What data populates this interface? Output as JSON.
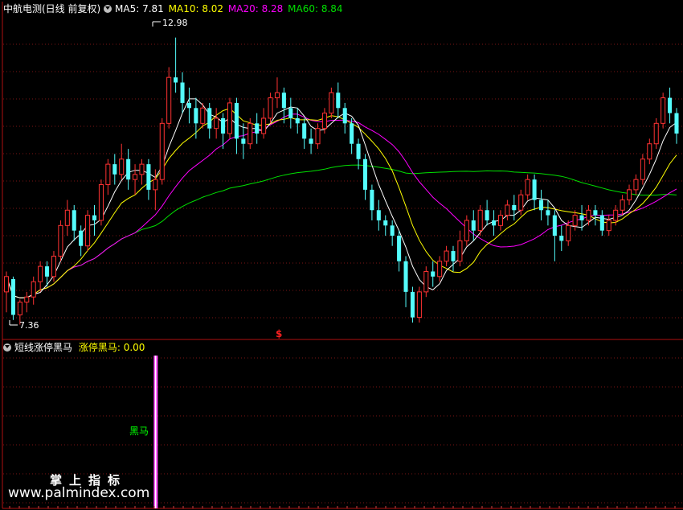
{
  "main_header": {
    "stock": "中航电测(日线 前复权)",
    "ma5_label": "MA5: 7.81",
    "ma10_label": "MA10: 8.02",
    "ma20_label": "MA20: 8.28",
    "ma60_label": "MA60: 8.84"
  },
  "sub_header": {
    "indicator": "短线涨停黑马",
    "value_label": "涨停黑马: 0.00"
  },
  "annotations": {
    "high": "12.98",
    "low": "7.36",
    "signal_marker": "$",
    "signal_text": "黑马"
  },
  "watermark": {
    "line1": "掌上指标",
    "line2": "www.palmindex.com"
  },
  "colors": {
    "up": "#ff3232",
    "down": "#54fcfc",
    "ma5": "#ffffff",
    "ma10": "#ffff00",
    "ma20": "#ff00ff",
    "ma60": "#00e000",
    "frame": "#b01010",
    "signal": "#ff40ff"
  },
  "chart_data": {
    "type": "candlestick",
    "price_range": [
      7.1,
      13.4
    ],
    "high_value": 12.98,
    "low_value": 7.36,
    "signal_bar_index": 22,
    "candles": [
      [
        8.0,
        8.3,
        8.4,
        7.6
      ],
      [
        8.25,
        7.55,
        8.3,
        7.45
      ],
      [
        7.55,
        7.8,
        7.85,
        7.36
      ],
      [
        7.8,
        7.9,
        8.0,
        7.6
      ],
      [
        7.9,
        8.2,
        8.3,
        7.75
      ],
      [
        8.2,
        8.5,
        8.6,
        8.0
      ],
      [
        8.5,
        8.3,
        8.6,
        8.1
      ],
      [
        8.3,
        8.7,
        8.8,
        8.2
      ],
      [
        8.7,
        9.3,
        9.4,
        8.6
      ],
      [
        9.3,
        9.6,
        9.8,
        9.1
      ],
      [
        9.6,
        9.2,
        9.7,
        9.0
      ],
      [
        9.2,
        8.9,
        9.3,
        8.7
      ],
      [
        8.9,
        9.5,
        9.6,
        8.8
      ],
      [
        9.5,
        9.4,
        9.7,
        9.1
      ],
      [
        9.4,
        10.1,
        10.2,
        9.3
      ],
      [
        10.1,
        10.5,
        10.6,
        9.9
      ],
      [
        10.5,
        10.3,
        10.7,
        10.1
      ],
      [
        10.3,
        10.6,
        10.9,
        10.2
      ],
      [
        10.6,
        10.2,
        10.8,
        10.0
      ],
      [
        10.2,
        10.3,
        10.5,
        9.9
      ],
      [
        10.3,
        10.5,
        10.6,
        10.1
      ],
      [
        10.5,
        10.0,
        10.6,
        9.8
      ],
      [
        10.0,
        10.2,
        10.4,
        9.6
      ],
      [
        10.2,
        11.3,
        11.4,
        10.1
      ],
      [
        11.3,
        12.2,
        12.4,
        11.2
      ],
      [
        12.2,
        12.1,
        12.98,
        11.9
      ],
      [
        12.1,
        11.7,
        12.3,
        11.5
      ],
      [
        11.7,
        11.6,
        12.0,
        11.3
      ],
      [
        11.6,
        11.3,
        11.8,
        11.0
      ],
      [
        11.3,
        11.6,
        11.7,
        11.2
      ],
      [
        11.6,
        11.2,
        11.7,
        11.0
      ],
      [
        11.2,
        11.4,
        11.6,
        11.0
      ],
      [
        11.4,
        11.1,
        11.5,
        10.8
      ],
      [
        11.1,
        11.7,
        11.8,
        11.0
      ],
      [
        11.7,
        11.0,
        11.8,
        10.7
      ],
      [
        11.0,
        10.9,
        11.3,
        10.6
      ],
      [
        10.9,
        11.3,
        11.4,
        10.8
      ],
      [
        11.3,
        11.1,
        11.5,
        10.9
      ],
      [
        11.1,
        11.4,
        11.6,
        11.0
      ],
      [
        11.4,
        11.8,
        11.9,
        11.3
      ],
      [
        11.8,
        11.9,
        12.2,
        11.6
      ],
      [
        11.9,
        11.6,
        12.0,
        11.3
      ],
      [
        11.6,
        11.4,
        11.8,
        11.2
      ],
      [
        11.4,
        11.3,
        11.6,
        11.1
      ],
      [
        11.3,
        11.0,
        11.4,
        10.8
      ],
      [
        11.0,
        10.9,
        11.2,
        10.7
      ],
      [
        10.9,
        11.2,
        11.3,
        10.8
      ],
      [
        11.2,
        11.5,
        11.6,
        11.1
      ],
      [
        11.5,
        11.9,
        12.0,
        11.4
      ],
      [
        11.9,
        11.6,
        12.1,
        11.4
      ],
      [
        11.6,
        11.3,
        11.7,
        11.1
      ],
      [
        11.3,
        10.9,
        11.4,
        10.7
      ],
      [
        10.9,
        10.6,
        11.0,
        10.4
      ],
      [
        10.6,
        10.0,
        10.7,
        9.8
      ],
      [
        10.0,
        9.6,
        10.1,
        9.4
      ],
      [
        9.6,
        9.4,
        9.8,
        9.2
      ],
      [
        9.4,
        9.3,
        9.5,
        9.1
      ],
      [
        9.3,
        9.1,
        9.4,
        8.9
      ],
      [
        9.1,
        8.6,
        9.2,
        8.4
      ],
      [
        8.6,
        8.0,
        8.7,
        7.7
      ],
      [
        8.0,
        7.5,
        8.1,
        7.4
      ],
      [
        7.5,
        8.0,
        8.1,
        7.4
      ],
      [
        8.0,
        8.4,
        8.5,
        7.9
      ],
      [
        8.4,
        8.3,
        8.6,
        8.1
      ],
      [
        8.3,
        8.6,
        8.7,
        8.2
      ],
      [
        8.6,
        8.8,
        8.9,
        8.5
      ],
      [
        8.8,
        8.6,
        8.9,
        8.4
      ],
      [
        8.6,
        9.0,
        9.2,
        8.5
      ],
      [
        9.0,
        9.4,
        9.5,
        8.9
      ],
      [
        9.4,
        9.2,
        9.6,
        9.0
      ],
      [
        9.2,
        9.6,
        9.7,
        9.1
      ],
      [
        9.6,
        9.4,
        9.8,
        9.3
      ],
      [
        9.4,
        9.3,
        9.6,
        9.1
      ],
      [
        9.3,
        9.5,
        9.6,
        9.2
      ],
      [
        9.5,
        9.7,
        9.8,
        9.4
      ],
      [
        9.7,
        9.6,
        9.9,
        9.4
      ],
      [
        9.6,
        9.9,
        10.0,
        9.5
      ],
      [
        9.9,
        10.2,
        10.3,
        9.8
      ],
      [
        10.2,
        9.8,
        10.3,
        9.6
      ],
      [
        9.8,
        9.6,
        10.0,
        9.4
      ],
      [
        9.6,
        9.5,
        9.8,
        9.3
      ],
      [
        9.5,
        9.1,
        9.6,
        8.6
      ],
      [
        9.1,
        9.0,
        9.3,
        8.8
      ],
      [
        9.0,
        9.3,
        9.4,
        8.9
      ],
      [
        9.3,
        9.5,
        9.6,
        9.2
      ],
      [
        9.5,
        9.4,
        9.7,
        9.2
      ],
      [
        9.4,
        9.6,
        9.7,
        9.3
      ],
      [
        9.6,
        9.5,
        9.7,
        9.3
      ],
      [
        9.5,
        9.2,
        9.6,
        9.1
      ],
      [
        9.2,
        9.4,
        9.5,
        9.1
      ],
      [
        9.4,
        9.6,
        9.7,
        9.3
      ],
      [
        9.6,
        9.8,
        9.9,
        9.5
      ],
      [
        9.8,
        10.0,
        10.1,
        9.7
      ],
      [
        10.0,
        10.2,
        10.3,
        9.9
      ],
      [
        10.2,
        10.6,
        10.7,
        10.1
      ],
      [
        10.6,
        10.9,
        11.0,
        10.5
      ],
      [
        10.9,
        11.3,
        11.4,
        10.8
      ],
      [
        11.3,
        11.8,
        11.9,
        11.2
      ],
      [
        11.8,
        11.5,
        12.0,
        11.3
      ],
      [
        11.5,
        11.1,
        11.6,
        10.9
      ]
    ]
  }
}
